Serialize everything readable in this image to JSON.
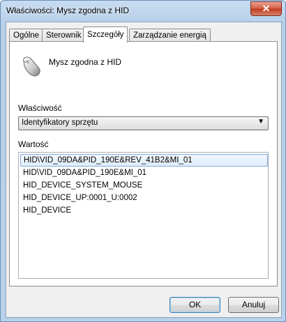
{
  "window": {
    "title": "Właściwości: Mysz zgodna z HID",
    "close_label": "✕"
  },
  "tabs": [
    {
      "label": "Ogólne"
    },
    {
      "label": "Sterownik"
    },
    {
      "label": "Szczegóły",
      "active": true
    },
    {
      "label": "Zarządzanie energią"
    }
  ],
  "device": {
    "icon": "mouse-icon",
    "name": "Mysz zgodna z HID"
  },
  "property": {
    "label": "Właściwość",
    "selected": "Identyfikatory sprzętu"
  },
  "value": {
    "label": "Wartość",
    "items": [
      "HID\\VID_09DA&PID_190E&REV_41B2&MI_01",
      "HID\\VID_09DA&PID_190E&MI_01",
      "HID_DEVICE_SYSTEM_MOUSE",
      "HID_DEVICE_UP:0001_U:0002",
      "HID_DEVICE"
    ],
    "selected_index": 0
  },
  "buttons": {
    "ok": "OK",
    "cancel": "Anuluj"
  }
}
